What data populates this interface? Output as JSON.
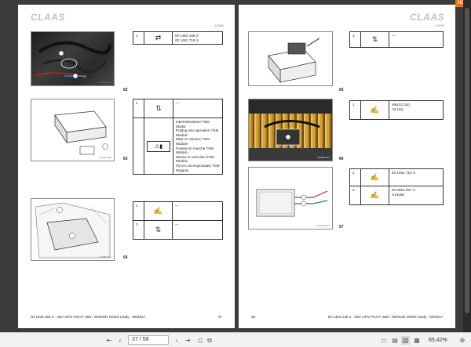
{
  "app": {
    "badge": "NEW"
  },
  "left_page": {
    "logo": "CLAAS",
    "code": "12/4/00",
    "figures": [
      {
        "num": "62",
        "code": "103590-001",
        "rows": [
          {
            "n": "1",
            "icon": "cable-connector-icon",
            "lines": [
              "00 1482 448 X",
              "00 1491 719 X"
            ]
          }
        ]
      },
      {
        "num": "63",
        "code": "149417-002",
        "rows": [
          {
            "n": "1",
            "icon": "connect-icon",
            "lines": [
              "—"
            ]
          },
          {
            "n": "",
            "icon": "warning-manual-icon",
            "lines": [
              "Inbetriebnahme TSM Modul",
              "Putting into operation TSM Module",
              "Mise en service TSM Module",
              "Puesta en marcha TSM Módulo",
              "Messa in esercizio TSM Modulo",
              "Пуск в эксплуатацию TSM Модуль"
            ]
          }
        ]
      },
      {
        "num": "64",
        "code": "103589-001",
        "rows": [
          {
            "n": "1",
            "icon": "wrench-icon",
            "lines": [
              "—"
            ]
          },
          {
            "n": "2",
            "icon": "connect-icon",
            "lines": [
              "—"
            ]
          }
        ]
      }
    ],
    "footer_left": "00 1403 225 2 - ABA GPS PILOT S66 / XERION GNSS ready - 06/2017",
    "footer_right": "37"
  },
  "right_page": {
    "logo": "CLAAS",
    "code": "12/4/00",
    "figures": [
      {
        "num": "65",
        "code": "",
        "rows": [
          {
            "n": "1",
            "icon": "connect-icon",
            "lines": [
              "—"
            ]
          }
        ]
      },
      {
        "num": "66",
        "code": "103588-001",
        "rows": [
          {
            "n": "1",
            "icon": "wrench-icon",
            "lines": [
              "M6x12 (2x)",
              "A6 (2x)"
            ]
          }
        ]
      },
      {
        "num": "67",
        "code": "149418-002",
        "rows": [
          {
            "n": "1",
            "icon": "wrench-icon",
            "lines": [
              "00 1491 719 X"
            ]
          },
          {
            "n": "2",
            "icon": "wrench-icon",
            "lines": [
              "00 0016 087 X",
              "X14159"
            ]
          }
        ]
      }
    ],
    "footer_left": "38",
    "footer_right": "00 1403 225 2 - ABA GPS PILOT S66 / XERION GNSS ready - 06/2017"
  },
  "toolbar": {
    "first": "⇤",
    "prev": "‹",
    "page": "37 / 58",
    "next": "›",
    "last": "⇥",
    "zoom": "65,42%"
  }
}
